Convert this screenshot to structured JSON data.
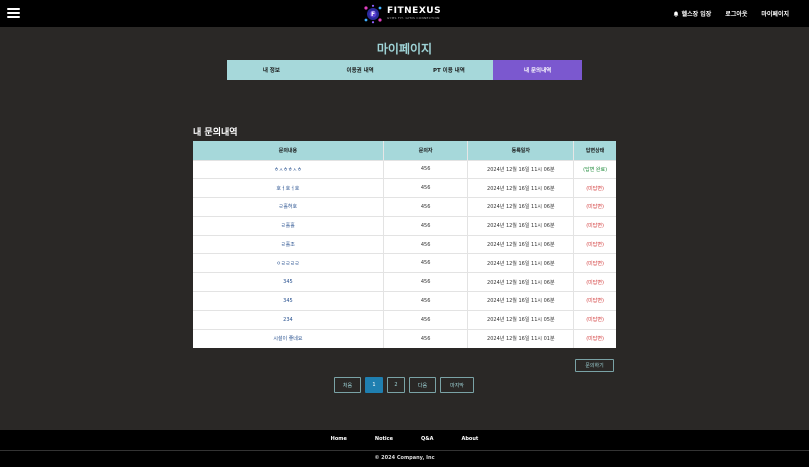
{
  "header": {
    "logo_name": "FITNEXUS",
    "logo_sub": "GYMS FIT. GYMS CONNECTION",
    "nav": [
      {
        "label": "헬스장 입장",
        "icon": "bell-icon"
      },
      {
        "label": "로그아웃"
      },
      {
        "label": "마이페이지"
      }
    ]
  },
  "page_title": "마이페이지",
  "tabs": [
    {
      "label": "내 정보",
      "active": false
    },
    {
      "label": "이용권 내역",
      "active": false
    },
    {
      "label": "PT 이용 내역",
      "active": false
    },
    {
      "label": "내 문의내역",
      "active": true
    }
  ],
  "section_title": "내 문의내역",
  "table": {
    "columns": [
      "문의내용",
      "문의자",
      "등록일자",
      "답변상태"
    ],
    "rows": [
      {
        "title": "ㅎㅅㅎㅎㅅㅎ",
        "author": "456",
        "date": "2024년 12월 16일 11시 06분",
        "status": "(답변 완료)",
        "done": true
      },
      {
        "title": "호ㅓ호ㅓ호",
        "author": "456",
        "date": "2024년 12월 16일 11시 06분",
        "status": "(미답변)",
        "done": false
      },
      {
        "title": "ㄹ홀허호",
        "author": "456",
        "date": "2024년 12월 16일 11시 06분",
        "status": "(미답변)",
        "done": false
      },
      {
        "title": "ㄹ홀홀",
        "author": "456",
        "date": "2024년 12월 16일 11시 06분",
        "status": "(미답변)",
        "done": false
      },
      {
        "title": "ㄹ홀조",
        "author": "456",
        "date": "2024년 12월 16일 11시 06분",
        "status": "(미답변)",
        "done": false
      },
      {
        "title": "ㅇㄹㄹㄹㄹ",
        "author": "456",
        "date": "2024년 12월 16일 11시 06분",
        "status": "(미답변)",
        "done": false
      },
      {
        "title": "345",
        "author": "456",
        "date": "2024년 12월 16일 11시 06분",
        "status": "(미답변)",
        "done": false
      },
      {
        "title": "345",
        "author": "456",
        "date": "2024년 12월 16일 11시 06분",
        "status": "(미답변)",
        "done": false
      },
      {
        "title": "234",
        "author": "456",
        "date": "2024년 12월 16일 11시 05분",
        "status": "(미답변)",
        "done": false
      },
      {
        "title": "시설이 좋네요",
        "author": "456",
        "date": "2024년 12월 16일 11시 01분",
        "status": "(미답변)",
        "done": false
      }
    ]
  },
  "inquire_button": "문의하기",
  "pagination": {
    "first": "처음",
    "pages": [
      "1",
      "2"
    ],
    "current": "1",
    "next": "다음",
    "last": "마지막"
  },
  "footer": {
    "links": [
      "Home",
      "Notice",
      "Q&A",
      "About"
    ],
    "copyright": "© 2024 Company, Inc"
  },
  "colors": {
    "accent_teal": "#a6d8da",
    "active_tab": "#7b58cf",
    "page_active": "#1f7fb0",
    "status_done": "#1e8a3a",
    "status_pending": "#d23a3a"
  }
}
